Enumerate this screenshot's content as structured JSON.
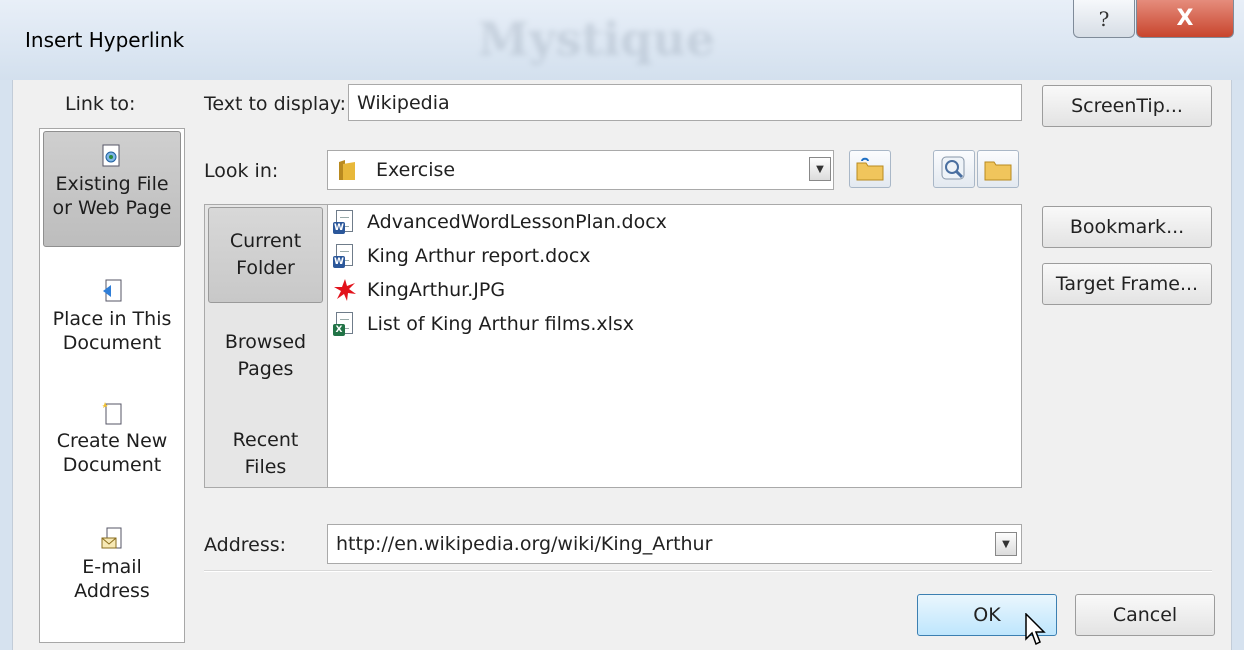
{
  "window": {
    "title": "Insert Hyperlink",
    "bg_watermark": "Mystique",
    "help_glyph": "?",
    "close_glyph": "X"
  },
  "link_to": {
    "label": "Link to:",
    "items": [
      {
        "line1": "Existing File",
        "line2": "or Web Page",
        "icon": "existing-file-icon",
        "selected": true
      },
      {
        "line1": "Place in This",
        "line2": "Document",
        "icon": "place-in-document-icon",
        "selected": false
      },
      {
        "line1": "Create New",
        "line2": "Document",
        "icon": "new-document-icon",
        "selected": false
      },
      {
        "line1": "E-mail",
        "line2": "Address",
        "icon": "email-icon",
        "selected": false
      }
    ]
  },
  "text_to_display": {
    "label": "Text to display:",
    "value": "Wikipedia"
  },
  "look_in": {
    "label": "Look in:",
    "value": "Exercise"
  },
  "browse_nav": [
    {
      "line1": "Current",
      "line2": "Folder",
      "selected": true
    },
    {
      "line1": "Browsed",
      "line2": "Pages",
      "selected": false
    },
    {
      "line1": "Recent",
      "line2": "Files",
      "selected": false
    }
  ],
  "files": [
    {
      "name": "AdvancedWordLessonPlan.docx",
      "type": "word"
    },
    {
      "name": "King Arthur report.docx",
      "type": "word"
    },
    {
      "name": "KingArthur.JPG",
      "type": "image"
    },
    {
      "name": "List of King Arthur films.xlsx",
      "type": "excel"
    }
  ],
  "address": {
    "label": "Address:",
    "value": "http://en.wikipedia.org/wiki/King_Arthur"
  },
  "buttons": {
    "screentip": "ScreenTip...",
    "bookmark": "Bookmark...",
    "target_frame": "Target Frame...",
    "ok": "OK",
    "cancel": "Cancel"
  },
  "colors": {
    "word_blue": "#2b579a",
    "excel_green": "#217346",
    "image_red": "#e2121b",
    "folder_yellow": "#e8b83a",
    "close_red": "#c8452d"
  }
}
